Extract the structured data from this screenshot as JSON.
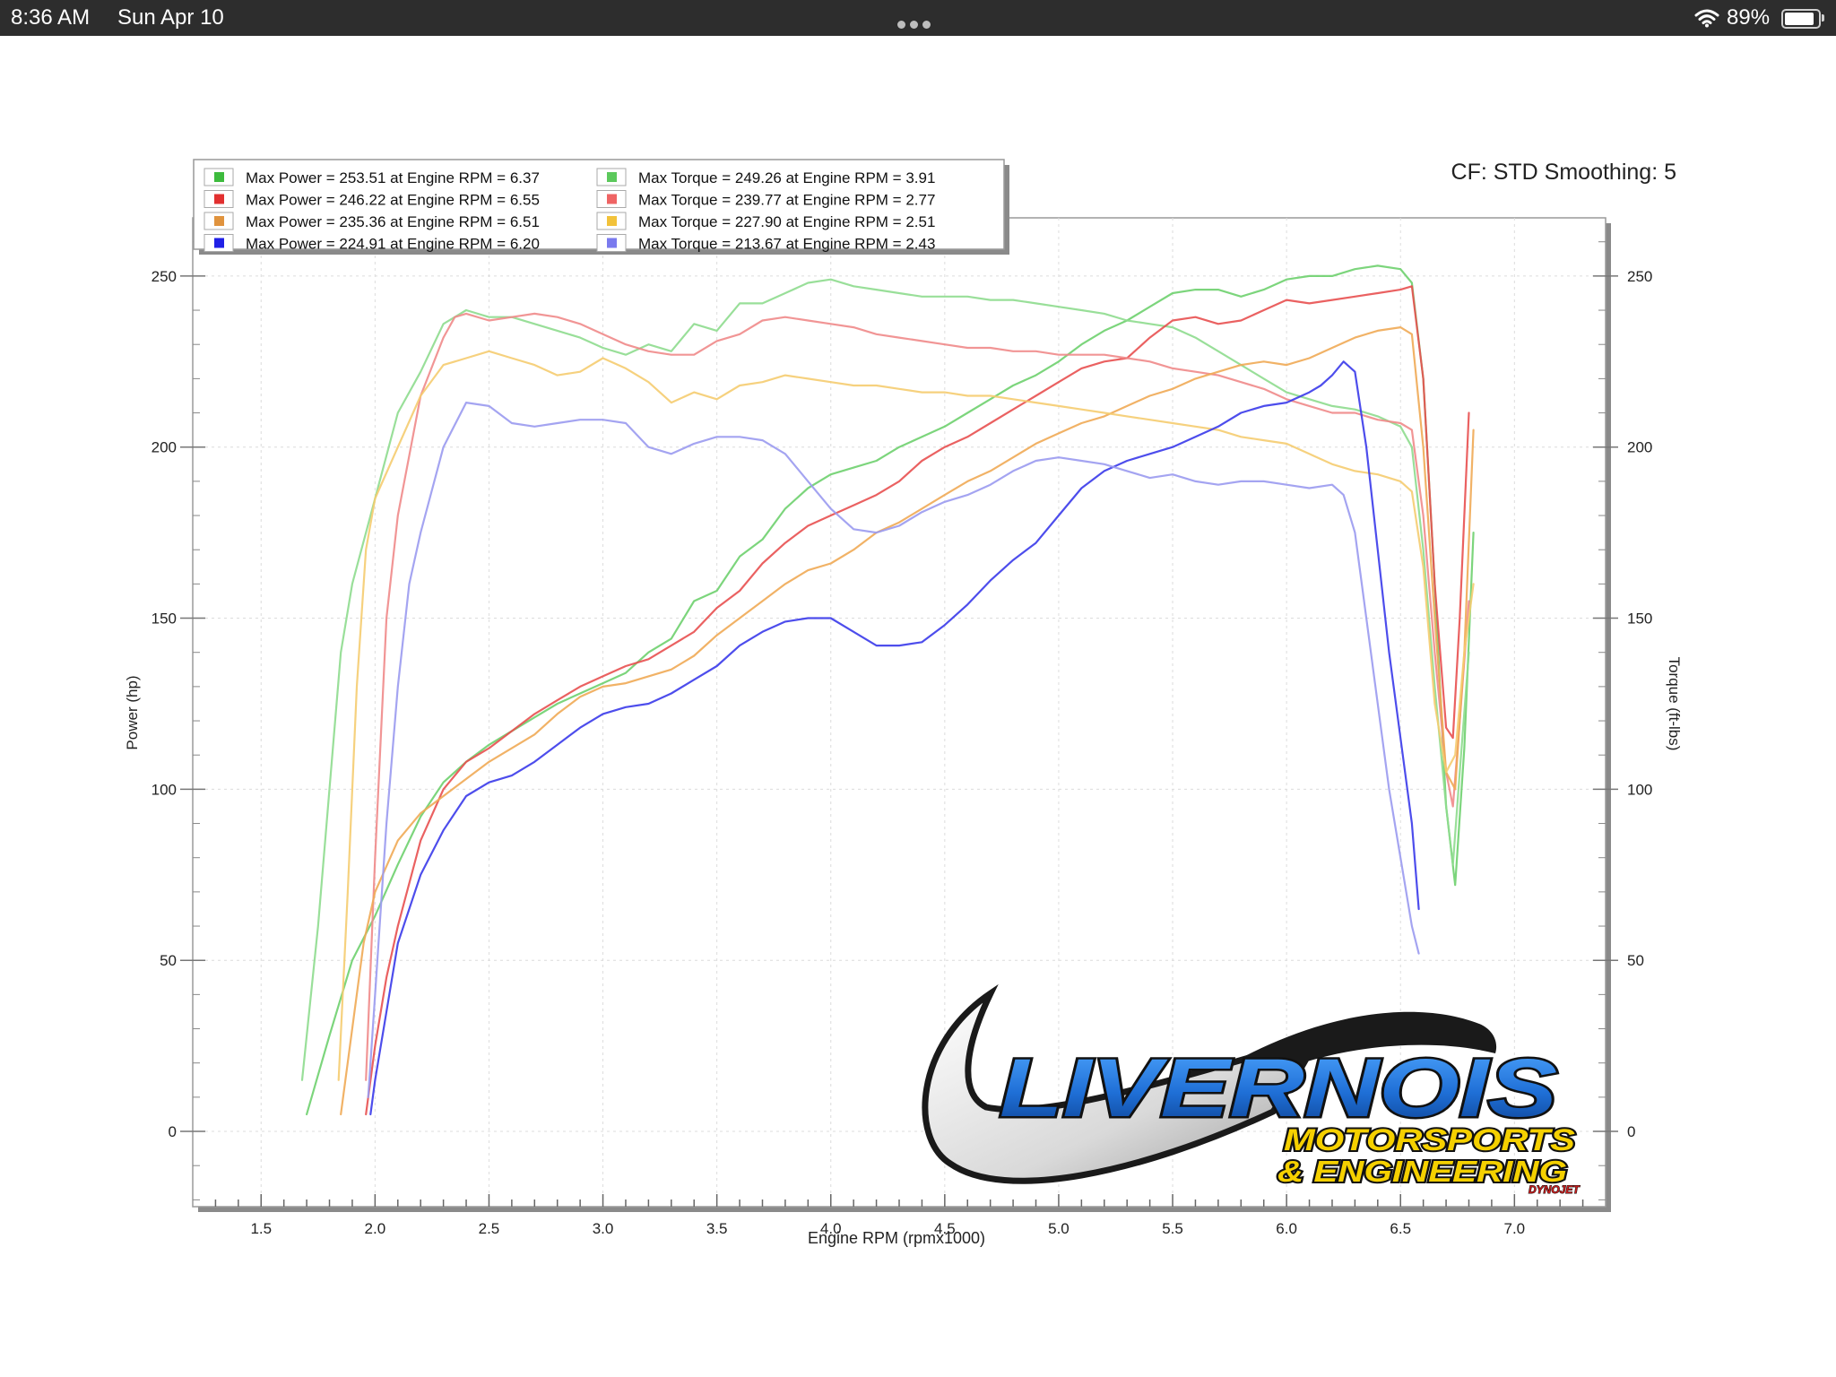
{
  "status_bar": {
    "time": "8:36 AM",
    "date": "Sun Apr 10",
    "battery": "89%",
    "battery_level": 0.89
  },
  "chart_data": {
    "type": "line",
    "corner_label": "CF: STD Smoothing: 5",
    "xlabel": "Engine RPM (rpmx1000)",
    "ylabel": "Power (hp)",
    "y2label": "Torque (ft-lbs)",
    "xlim": [
      1.2,
      7.4
    ],
    "ylim": [
      -22,
      267
    ],
    "x_ticks": [
      "1.5",
      "2.0",
      "2.5",
      "3.0",
      "3.5",
      "4.0",
      "4.5",
      "5.0",
      "5.5",
      "6.0",
      "6.5",
      "7.0"
    ],
    "y_ticks": [
      "0",
      "50",
      "100",
      "150",
      "200",
      "250"
    ],
    "y2_ticks": [
      "0",
      "50",
      "100",
      "150",
      "200",
      "250"
    ],
    "grid": true,
    "legend_position": "top-left",
    "legend": [
      {
        "label": "Max Power = 253.51 at Engine RPM = 6.37",
        "color": "#3dbb3d"
      },
      {
        "label": "Max Torque = 249.26 at Engine RPM = 3.91",
        "color": "#5cc95c"
      },
      {
        "label": "Max Power = 246.22 at Engine RPM = 6.55",
        "color": "#e23030"
      },
      {
        "label": "Max Torque = 239.77 at Engine RPM = 2.77",
        "color": "#ef6464"
      },
      {
        "label": "Max Power = 235.36 at Engine RPM = 6.51",
        "color": "#e0933e"
      },
      {
        "label": "Max Torque = 227.90 at Engine RPM = 2.51",
        "color": "#f2c23a"
      },
      {
        "label": "Max Power = 224.91 at Engine RPM = 6.20",
        "color": "#2020e6"
      },
      {
        "label": "Max Torque = 213.67 at Engine RPM = 2.43",
        "color": "#7a7aee"
      }
    ],
    "series": [
      {
        "kind": "power",
        "color": "#6ed06e",
        "x": [
          1.7,
          1.8,
          1.9,
          2.0,
          2.1,
          2.2,
          2.3,
          2.4,
          2.5,
          2.6,
          2.7,
          2.8,
          2.9,
          3.0,
          3.1,
          3.2,
          3.3,
          3.4,
          3.5,
          3.6,
          3.7,
          3.8,
          3.9,
          4.0,
          4.1,
          4.2,
          4.3,
          4.4,
          4.5,
          4.6,
          4.7,
          4.8,
          4.9,
          5.0,
          5.1,
          5.2,
          5.3,
          5.4,
          5.5,
          5.6,
          5.7,
          5.8,
          5.9,
          6.0,
          6.1,
          6.2,
          6.3,
          6.4,
          6.5,
          6.55,
          6.6,
          6.65,
          6.7,
          6.74,
          6.78,
          6.82
        ],
        "y": [
          5,
          28,
          50,
          63,
          78,
          92,
          102,
          108,
          113,
          117,
          121,
          125,
          128,
          131,
          134,
          140,
          144,
          155,
          158,
          168,
          173,
          182,
          188,
          192,
          194,
          196,
          200,
          203,
          206,
          210,
          214,
          218,
          221,
          225,
          230,
          234,
          237,
          241,
          245,
          246,
          246,
          244,
          246,
          249,
          250,
          250,
          252,
          253,
          252,
          248,
          220,
          160,
          95,
          72,
          112,
          175
        ]
      },
      {
        "kind": "torque",
        "color": "#8edc8e",
        "x": [
          1.68,
          1.75,
          1.8,
          1.85,
          1.9,
          2.0,
          2.1,
          2.2,
          2.3,
          2.4,
          2.5,
          2.6,
          2.7,
          2.8,
          2.9,
          3.0,
          3.1,
          3.2,
          3.3,
          3.4,
          3.5,
          3.6,
          3.7,
          3.8,
          3.9,
          4.0,
          4.1,
          4.2,
          4.3,
          4.4,
          4.5,
          4.6,
          4.7,
          4.8,
          4.9,
          5.0,
          5.1,
          5.2,
          5.3,
          5.4,
          5.5,
          5.6,
          5.7,
          5.8,
          5.9,
          6.0,
          6.1,
          6.2,
          6.3,
          6.4,
          6.5,
          6.55,
          6.6,
          6.65,
          6.7,
          6.73,
          6.76,
          6.8
        ],
        "y": [
          15,
          60,
          100,
          140,
          160,
          185,
          210,
          222,
          236,
          240,
          238,
          238,
          236,
          234,
          232,
          229,
          227,
          230,
          228,
          236,
          234,
          242,
          242,
          245,
          248,
          249,
          247,
          246,
          245,
          244,
          244,
          244,
          243,
          243,
          242,
          241,
          240,
          239,
          237,
          236,
          235,
          232,
          228,
          224,
          220,
          216,
          214,
          212,
          211,
          209,
          206,
          200,
          170,
          130,
          95,
          78,
          105,
          140
        ]
      },
      {
        "kind": "power",
        "color": "#e85050",
        "x": [
          1.96,
          2.0,
          2.05,
          2.1,
          2.2,
          2.3,
          2.4,
          2.5,
          2.6,
          2.7,
          2.8,
          2.9,
          3.0,
          3.1,
          3.2,
          3.3,
          3.4,
          3.5,
          3.6,
          3.7,
          3.8,
          3.9,
          4.0,
          4.1,
          4.2,
          4.3,
          4.4,
          4.5,
          4.6,
          4.7,
          4.8,
          4.9,
          5.0,
          5.1,
          5.2,
          5.3,
          5.4,
          5.5,
          5.6,
          5.7,
          5.8,
          5.9,
          6.0,
          6.1,
          6.2,
          6.3,
          6.4,
          6.5,
          6.55,
          6.6,
          6.65,
          6.7,
          6.73,
          6.76,
          6.8
        ],
        "y": [
          5,
          25,
          45,
          60,
          85,
          100,
          108,
          112,
          117,
          122,
          126,
          130,
          133,
          136,
          138,
          142,
          146,
          153,
          158,
          166,
          172,
          177,
          180,
          183,
          186,
          190,
          196,
          200,
          203,
          207,
          211,
          215,
          219,
          223,
          225,
          226,
          232,
          237,
          238,
          236,
          237,
          240,
          243,
          242,
          243,
          244,
          245,
          246,
          247,
          220,
          160,
          118,
          115,
          150,
          210
        ]
      },
      {
        "kind": "torque",
        "color": "#f08a8a",
        "x": [
          1.96,
          2.0,
          2.05,
          2.1,
          2.2,
          2.3,
          2.35,
          2.4,
          2.5,
          2.6,
          2.7,
          2.8,
          2.9,
          3.0,
          3.1,
          3.2,
          3.3,
          3.4,
          3.5,
          3.6,
          3.7,
          3.8,
          3.9,
          4.0,
          4.1,
          4.2,
          4.3,
          4.4,
          4.5,
          4.6,
          4.7,
          4.8,
          4.9,
          5.0,
          5.1,
          5.2,
          5.3,
          5.4,
          5.5,
          5.6,
          5.7,
          5.8,
          5.9,
          6.0,
          6.1,
          6.2,
          6.3,
          6.4,
          6.5,
          6.55,
          6.6,
          6.65,
          6.7,
          6.73,
          6.76,
          6.8
        ],
        "y": [
          15,
          80,
          150,
          180,
          215,
          232,
          238,
          239,
          237,
          238,
          239,
          238,
          236,
          233,
          230,
          228,
          227,
          227,
          231,
          233,
          237,
          238,
          237,
          236,
          235,
          233,
          232,
          231,
          230,
          229,
          229,
          228,
          228,
          227,
          227,
          227,
          226,
          225,
          223,
          222,
          221,
          219,
          217,
          214,
          212,
          210,
          210,
          208,
          207,
          205,
          180,
          140,
          105,
          95,
          120,
          155
        ]
      },
      {
        "kind": "power",
        "color": "#f0aa55",
        "x": [
          1.85,
          1.9,
          1.95,
          2.0,
          2.1,
          2.2,
          2.3,
          2.4,
          2.5,
          2.6,
          2.7,
          2.8,
          2.9,
          3.0,
          3.1,
          3.2,
          3.3,
          3.4,
          3.5,
          3.6,
          3.7,
          3.8,
          3.9,
          4.0,
          4.1,
          4.2,
          4.3,
          4.4,
          4.5,
          4.6,
          4.7,
          4.8,
          4.9,
          5.0,
          5.1,
          5.2,
          5.3,
          5.4,
          5.5,
          5.6,
          5.7,
          5.8,
          5.9,
          6.0,
          6.1,
          6.2,
          6.3,
          6.4,
          6.5,
          6.55,
          6.6,
          6.65,
          6.7,
          6.74,
          6.78,
          6.82
        ],
        "y": [
          5,
          30,
          55,
          70,
          85,
          93,
          98,
          103,
          108,
          112,
          116,
          122,
          127,
          130,
          131,
          133,
          135,
          139,
          145,
          150,
          155,
          160,
          164,
          166,
          170,
          175,
          178,
          182,
          186,
          190,
          193,
          197,
          201,
          204,
          207,
          209,
          212,
          215,
          217,
          220,
          222,
          224,
          225,
          224,
          226,
          229,
          232,
          234,
          235,
          233,
          200,
          150,
          105,
          100,
          140,
          205
        ]
      },
      {
        "kind": "torque",
        "color": "#f5cc70",
        "x": [
          1.84,
          1.88,
          1.92,
          1.96,
          2.0,
          2.1,
          2.2,
          2.3,
          2.4,
          2.5,
          2.6,
          2.7,
          2.8,
          2.9,
          3.0,
          3.1,
          3.2,
          3.3,
          3.4,
          3.5,
          3.6,
          3.7,
          3.8,
          3.9,
          4.0,
          4.1,
          4.2,
          4.3,
          4.4,
          4.5,
          4.6,
          4.7,
          4.8,
          4.9,
          5.0,
          5.1,
          5.2,
          5.3,
          5.4,
          5.5,
          5.6,
          5.7,
          5.8,
          5.9,
          6.0,
          6.1,
          6.2,
          6.3,
          6.4,
          6.5,
          6.55,
          6.6,
          6.65,
          6.7,
          6.74,
          6.78,
          6.82
        ],
        "y": [
          15,
          70,
          130,
          170,
          185,
          200,
          215,
          224,
          226,
          228,
          226,
          224,
          221,
          222,
          226,
          223,
          219,
          213,
          216,
          214,
          218,
          219,
          221,
          220,
          219,
          218,
          218,
          217,
          216,
          216,
          215,
          215,
          214,
          213,
          212,
          211,
          210,
          209,
          208,
          207,
          206,
          205,
          203,
          202,
          201,
          198,
          195,
          193,
          192,
          190,
          187,
          165,
          125,
          105,
          110,
          140,
          160
        ]
      },
      {
        "kind": "power",
        "color": "#3a3aea",
        "x": [
          1.98,
          2.0,
          2.05,
          2.1,
          2.2,
          2.3,
          2.4,
          2.5,
          2.6,
          2.7,
          2.8,
          2.9,
          3.0,
          3.1,
          3.2,
          3.3,
          3.4,
          3.5,
          3.6,
          3.7,
          3.8,
          3.9,
          4.0,
          4.1,
          4.2,
          4.3,
          4.4,
          4.5,
          4.6,
          4.7,
          4.8,
          4.9,
          5.0,
          5.1,
          5.2,
          5.3,
          5.4,
          5.5,
          5.6,
          5.7,
          5.8,
          5.9,
          6.0,
          6.1,
          6.15,
          6.2,
          6.25,
          6.3,
          6.35,
          6.4,
          6.45,
          6.5,
          6.55,
          6.58
        ],
        "y": [
          5,
          15,
          35,
          55,
          75,
          88,
          98,
          102,
          104,
          108,
          113,
          118,
          122,
          124,
          125,
          128,
          132,
          136,
          142,
          146,
          149,
          150,
          150,
          146,
          142,
          142,
          143,
          148,
          154,
          161,
          167,
          172,
          180,
          188,
          193,
          196,
          198,
          200,
          203,
          206,
          210,
          212,
          213,
          216,
          218,
          221,
          225,
          222,
          200,
          170,
          140,
          115,
          90,
          65
        ]
      },
      {
        "kind": "torque",
        "color": "#9a9af0",
        "x": [
          1.97,
          2.0,
          2.05,
          2.1,
          2.15,
          2.2,
          2.3,
          2.4,
          2.5,
          2.6,
          2.7,
          2.8,
          2.9,
          3.0,
          3.1,
          3.2,
          3.3,
          3.4,
          3.5,
          3.6,
          3.7,
          3.8,
          3.9,
          4.0,
          4.1,
          4.2,
          4.3,
          4.4,
          4.5,
          4.6,
          4.7,
          4.8,
          4.9,
          5.0,
          5.1,
          5.2,
          5.3,
          5.4,
          5.5,
          5.6,
          5.7,
          5.8,
          5.9,
          6.0,
          6.1,
          6.2,
          6.25,
          6.3,
          6.35,
          6.4,
          6.45,
          6.5,
          6.55,
          6.58
        ],
        "y": [
          10,
          40,
          90,
          130,
          160,
          175,
          200,
          213,
          212,
          207,
          206,
          207,
          208,
          208,
          207,
          200,
          198,
          201,
          203,
          203,
          202,
          198,
          190,
          182,
          176,
          175,
          177,
          181,
          184,
          186,
          189,
          193,
          196,
          197,
          196,
          195,
          193,
          191,
          192,
          190,
          189,
          190,
          190,
          189,
          188,
          189,
          186,
          175,
          150,
          125,
          100,
          80,
          60,
          52
        ]
      }
    ]
  },
  "branding": {
    "line1": "LIVERNOIS",
    "line2": "MOTORSPORTS",
    "line3": "& ENGINEERING",
    "badge": "DYNOJET"
  }
}
